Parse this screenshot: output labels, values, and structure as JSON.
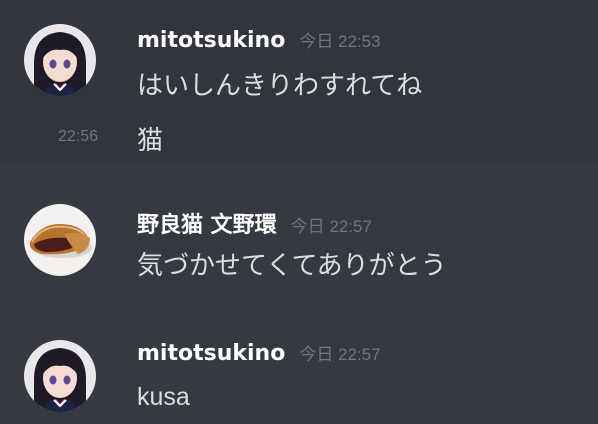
{
  "messages": [
    {
      "username": "mitotsukino",
      "timestamp": "今日 22:53",
      "avatar_icon": "anime-girl-avatar",
      "lines": [
        {
          "text": "はいしんきりわすれてね"
        },
        {
          "side_time": "22:56",
          "text": "猫"
        }
      ]
    },
    {
      "username": "野良猫 文野環",
      "timestamp": "今日 22:57",
      "avatar_icon": "dorayaki-avatar",
      "lines": [
        {
          "text": "気づかせてくてありがとう"
        }
      ]
    },
    {
      "username": "mitotsukino",
      "timestamp": "今日 22:57",
      "avatar_icon": "anime-girl-avatar",
      "lines": [
        {
          "text": "kusa"
        }
      ]
    }
  ],
  "colors": {
    "background": "#36393f",
    "hover_background": "#32353b",
    "username": "#ffffff",
    "timestamp": "#72767d",
    "message_text": "#dcddde"
  }
}
